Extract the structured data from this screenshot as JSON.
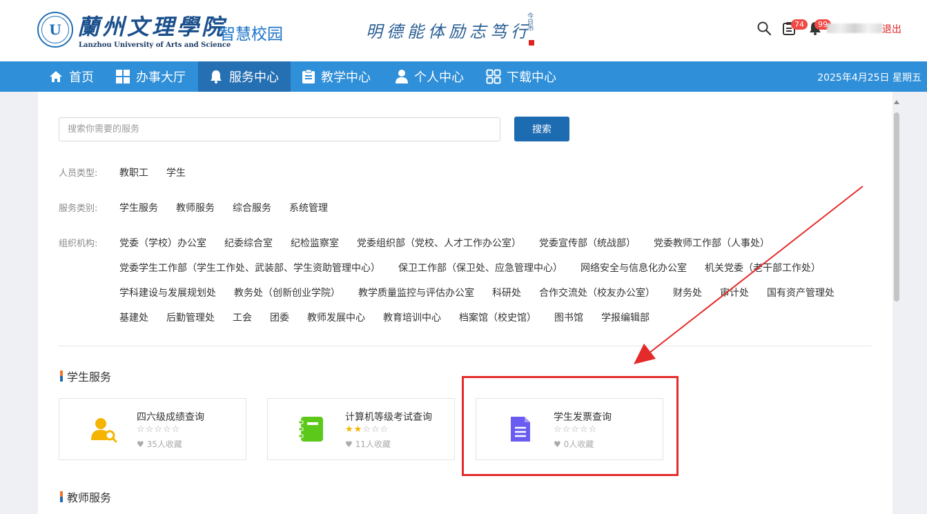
{
  "header": {
    "logo_cn": "蘭州文理學院",
    "logo_en": "Lanzhou University of Arts and Science",
    "logo_mark": "U",
    "system_name": "智慧校园",
    "motto": "明德能体励志笃行",
    "motto_sign": "今日书",
    "notifications": [
      {
        "icon": "todo-list-icon",
        "count": "74"
      },
      {
        "icon": "bell-icon",
        "count": "99"
      }
    ],
    "logout_label": "退出"
  },
  "nav": {
    "items": [
      {
        "label": "首页",
        "icon": "home-icon"
      },
      {
        "label": "办事大厅",
        "icon": "grid-icon"
      },
      {
        "label": "服务中心",
        "icon": "bell-icon",
        "active": true
      },
      {
        "label": "教学中心",
        "icon": "clipboard-icon"
      },
      {
        "label": "个人中心",
        "icon": "user-icon"
      },
      {
        "label": "下载中心",
        "icon": "apps-icon"
      }
    ],
    "date": "2025年4月25日 星期五"
  },
  "search": {
    "placeholder": "搜索你需要的服务",
    "button_label": "搜索"
  },
  "filters": {
    "person_type": {
      "label": "人员类型:",
      "options": [
        "教职工",
        "学生"
      ]
    },
    "service_category": {
      "label": "服务类别:",
      "options": [
        "学生服务",
        "教师服务",
        "综合服务",
        "系统管理"
      ]
    },
    "organization": {
      "label": "组织机构:",
      "rows": [
        [
          "党委（学校）办公室",
          "纪委综合室",
          "纪检监察室",
          "党委组织部（党校、人才工作办公室）",
          "党委宣传部（统战部）",
          "党委教师工作部（人事处）"
        ],
        [
          "党委学生工作部（学生工作处、武装部、学生资助管理中心）",
          "保卫工作部（保卫处、应急管理中心）",
          "网络安全与信息化办公室",
          "机关党委（老干部工作处）"
        ],
        [
          "学科建设与发展规划处",
          "教务处（创新创业学院）",
          "教学质量监控与评估办公室",
          "科研处",
          "合作交流处（校友办公室）",
          "财务处",
          "审计处",
          "国有资产管理处"
        ],
        [
          "基建处",
          "后勤管理处",
          "工会",
          "团委",
          "教师发展中心",
          "教育培训中心",
          "档案馆（校史馆）",
          "图书馆",
          "学报编辑部"
        ]
      ]
    }
  },
  "sections": [
    {
      "title": "学生服务",
      "cards": [
        {
          "title": "四六级成绩查询",
          "icon": "user-search-icon",
          "rating": 0,
          "favorites": "35人收藏",
          "icon_color": "#f5b400"
        },
        {
          "title": "计算机等级考试查询",
          "icon": "notebook-icon",
          "rating": 2,
          "favorites": "11人收藏",
          "icon_color": "#5cc91a"
        },
        {
          "title": "学生发票查询",
          "icon": "document-icon",
          "rating": 0,
          "favorites": "0人收藏",
          "icon_color": "#6a5cf0"
        }
      ]
    },
    {
      "title": "教师服务",
      "cards": []
    }
  ],
  "colors": {
    "nav_bg": "#2f8fd8",
    "nav_active": "#2570b3",
    "button": "#1d6bb1",
    "annotation": "#e52a2a"
  }
}
